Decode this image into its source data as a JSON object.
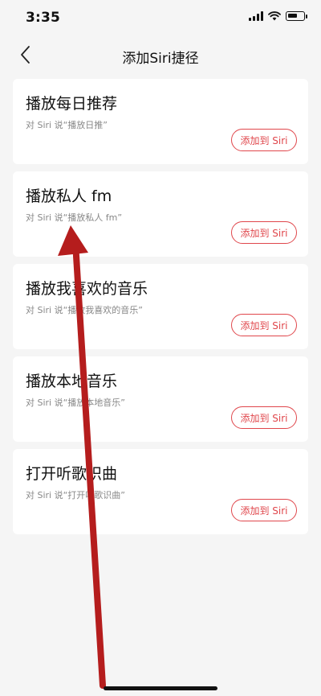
{
  "status_bar": {
    "time": "3:35"
  },
  "nav": {
    "title": "添加Siri捷径"
  },
  "shortcuts": [
    {
      "title": "播放每日推荐",
      "phrase": "对 Siri 说“播放日推”",
      "button": "添加到 Siri"
    },
    {
      "title": "播放私人 fm",
      "phrase": "对 Siri 说“播放私人 fm”",
      "button": "添加到 Siri"
    },
    {
      "title": "播放我喜欢的音乐",
      "phrase": "对 Siri 说“播放我喜欢的音乐”",
      "button": "添加到 Siri"
    },
    {
      "title": "播放本地音乐",
      "phrase": "对 Siri 说“播放本地音乐”",
      "button": "添加到 Siri"
    },
    {
      "title": "打开听歌识曲",
      "phrase": "对 Siri 说“打开听歌识曲”",
      "button": "添加到 Siri"
    }
  ],
  "colors": {
    "accent": "#e0474c",
    "background": "#f5f5f5",
    "card": "#ffffff",
    "annotation_arrow": "#b51d1d"
  }
}
